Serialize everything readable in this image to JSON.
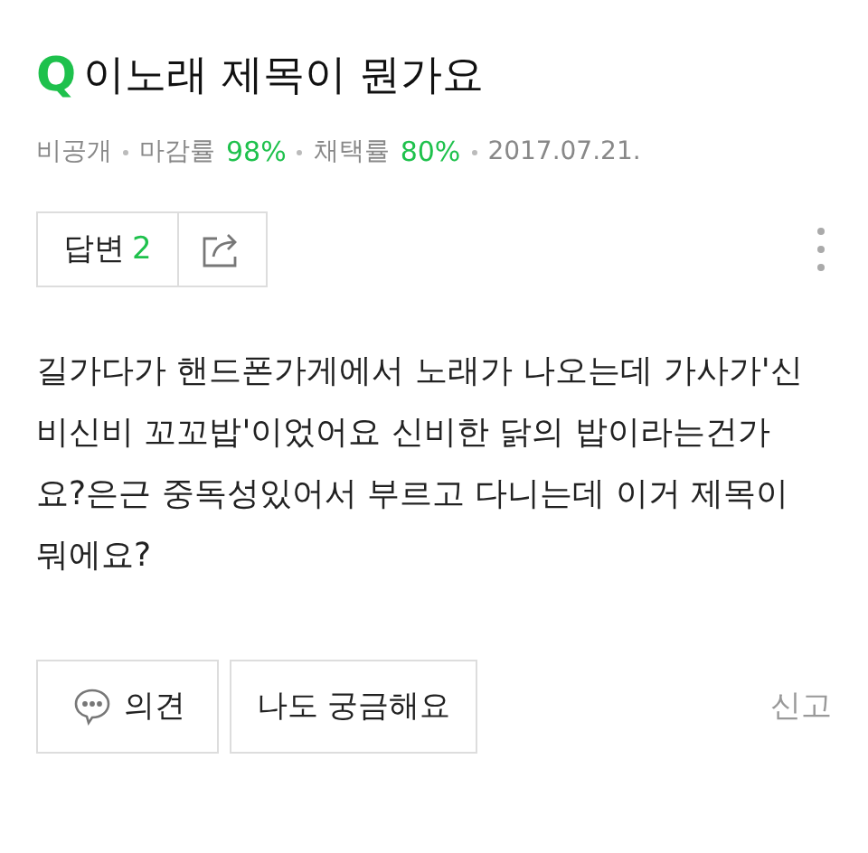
{
  "question": {
    "badge": "Q",
    "title": "이노래 제목이 뭔가요"
  },
  "meta": [
    {
      "label": "비공개"
    },
    {
      "label": "마감률",
      "value": "98%"
    },
    {
      "label": "채택률",
      "value": "80%"
    },
    {
      "label": "2017.07.21."
    }
  ],
  "answers": {
    "label": "답변",
    "count": "2"
  },
  "body": "길가다가 핸드폰가게에서 노래가 나오는데 가사가'신비신비 꼬꼬밥'이었어요 신비한 닭의 밥이라는건가요?은근 중독성있어서 부르고 다니는데 이거 제목이 뭐에요?",
  "actions": [
    {
      "kind": "comment",
      "label": "의견"
    },
    {
      "kind": "plain",
      "label": "나도 궁금해요"
    }
  ],
  "report": "신고"
}
